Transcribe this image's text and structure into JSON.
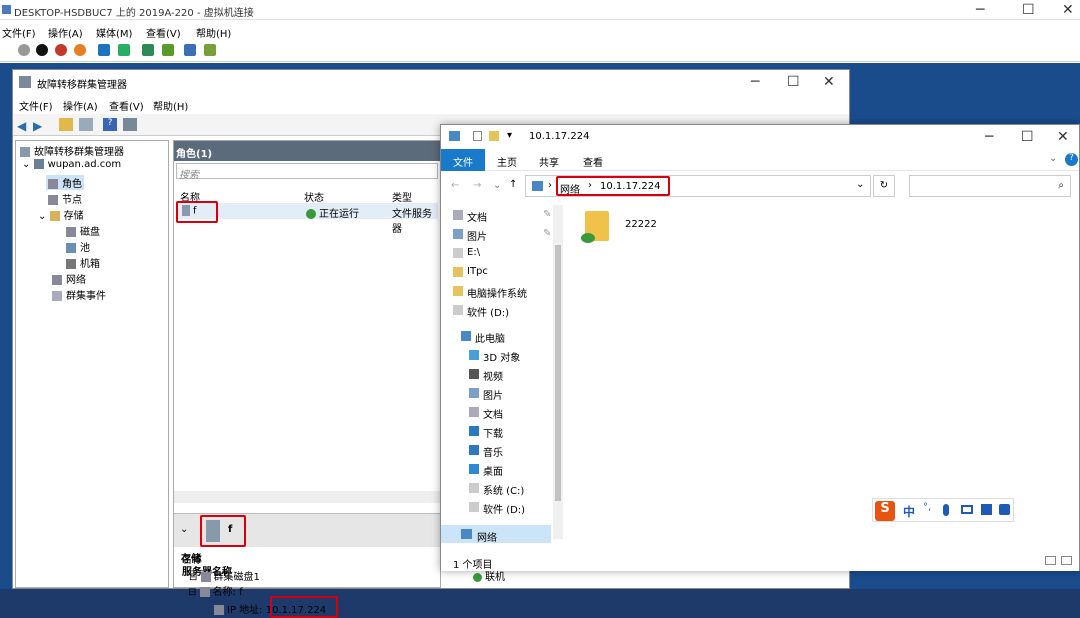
{
  "vm": {
    "title": "DESKTOP-HSDBUC7 上的 2019A-220 - 虚拟机连接",
    "menu": [
      "文件(F)",
      "操作(A)",
      "媒体(M)",
      "查看(V)",
      "帮助(H)"
    ]
  },
  "fcm": {
    "title": "故障转移群集管理器",
    "menu": [
      "文件(F)",
      "操作(A)",
      "查看(V)",
      "帮助(H)"
    ],
    "tree": {
      "root": "故障转移群集管理器",
      "cluster": "wupan.ad.com",
      "items": [
        "角色",
        "节点",
        "存储",
        "磁盘",
        "池",
        "机箱",
        "网络",
        "群集事件"
      ]
    },
    "roles_header": "角色(1)",
    "search_placeholder": "搜索",
    "columns": [
      "名称",
      "状态",
      "类型"
    ],
    "row": {
      "name": "f",
      "status": "正在运行",
      "type": "文件服务器"
    },
    "detail": {
      "name": "f",
      "col_name": "名称",
      "section_server": "服务器名称",
      "name_label": "名称: f",
      "ip_label": "IP 地址:",
      "ip_value": "10.1.17.224",
      "section_storage": "存储",
      "disk": "群集磁盘1",
      "disk_status": "联机"
    }
  },
  "explorer": {
    "title": "10.1.17.224",
    "tabs": [
      "文件",
      "主页",
      "共享",
      "查看"
    ],
    "breadcrumb": [
      "网络",
      "10.1.17.224"
    ],
    "nav": {
      "quick": [
        "文档",
        "图片",
        "E:\\",
        "ITpc",
        "电脑操作系统",
        "软件 (D:)"
      ],
      "pc_label": "此电脑",
      "pc": [
        "3D 对象",
        "视频",
        "图片",
        "文档",
        "下载",
        "音乐",
        "桌面",
        "系统 (C:)",
        "软件 (D:)"
      ],
      "network": "网络"
    },
    "folder": "22222",
    "status": "1 个项目"
  },
  "ime": {
    "label": "中"
  },
  "colors": {
    "accent": "#1979ca",
    "highlight": "#d8000c",
    "desktop": "#1a4c8c"
  }
}
